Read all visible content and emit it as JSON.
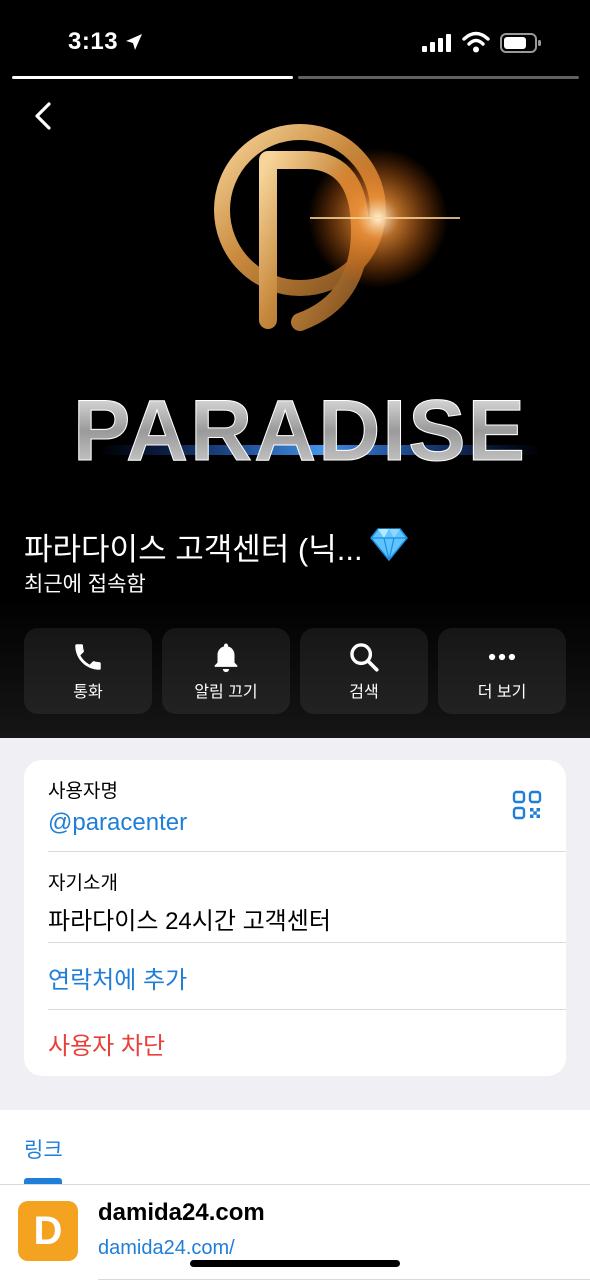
{
  "status_bar": {
    "time": "3:13",
    "icons": [
      "location-arrow-icon",
      "cellular-signal-icon",
      "wifi-icon",
      "battery-icon"
    ]
  },
  "stories": {
    "count": 2,
    "active_index": 0
  },
  "hero": {
    "logo_text": "PARADISE",
    "logo_mark": "D",
    "profile_name": "파라다이스 고객센터 (닉...",
    "badge_icon": "diamond-icon",
    "profile_status": "최근에 접속함"
  },
  "actions": [
    {
      "label": "통화",
      "icon": "phone-icon"
    },
    {
      "label": "알림 끄기",
      "icon": "bell-icon"
    },
    {
      "label": "검색",
      "icon": "search-icon"
    },
    {
      "label": "더 보기",
      "icon": "more-icon"
    }
  ],
  "info": {
    "username_label": "사용자명",
    "username_value": "@paracenter",
    "bio_label": "자기소개",
    "bio_value": "파라다이스 24시간 고객센터",
    "add_contact": "연락처에 추가",
    "block_user": "사용자 차단"
  },
  "links": {
    "title": "링크",
    "items": [
      {
        "avatar_letter": "D",
        "title": "damida24.com",
        "url": "damida24.com/"
      }
    ]
  },
  "colors": {
    "accent": "#1f7ed8",
    "danger": "#e8403a",
    "link_avatar": "#f3a320",
    "hero_bg": "#000000",
    "page_bg": "#efeff4"
  }
}
